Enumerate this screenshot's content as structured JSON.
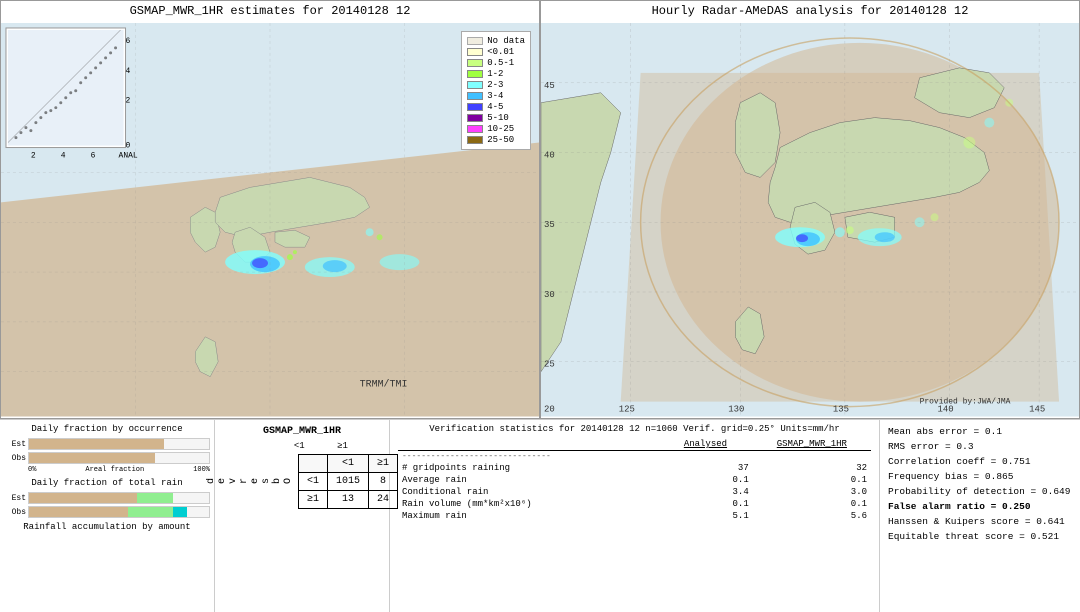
{
  "left_map": {
    "title": "GSMAP_MWR_1HR estimates for 20140128 12",
    "labels": {
      "trmm": "TRMM/TMI",
      "anal": "ANAL"
    }
  },
  "right_map": {
    "title": "Hourly Radar-AMeDAS analysis for 20140128 12",
    "credit": "Provided by:JWA/JMA",
    "lat_labels": [
      "45",
      "40",
      "35",
      "30",
      "25",
      "20"
    ],
    "lon_labels": [
      "125",
      "130",
      "135",
      "140",
      "145"
    ]
  },
  "legend": {
    "title": "No data",
    "items": [
      {
        "label": "No data",
        "color": "#f5f5f5"
      },
      {
        "label": "<0.01",
        "color": "#fffdd0"
      },
      {
        "label": "0.5-1",
        "color": "#adff2f"
      },
      {
        "label": "1-2",
        "color": "#7fff00"
      },
      {
        "label": "2-3",
        "color": "#00ffff"
      },
      {
        "label": "3-4",
        "color": "#00bfff"
      },
      {
        "label": "4-5",
        "color": "#0000ff"
      },
      {
        "label": "5-10",
        "color": "#8b008b"
      },
      {
        "label": "10-25",
        "color": "#ff00ff"
      },
      {
        "label": "25-50",
        "color": "#8b4513"
      }
    ]
  },
  "charts": {
    "occurrence_title": "Daily fraction by occurrence",
    "rain_title": "Daily fraction of total rain",
    "accumulation_title": "Rainfall accumulation by amount",
    "est_label": "Est",
    "obs_label": "Obs",
    "axis_0": "0%",
    "axis_100": "Areal fraction",
    "axis_100_pct": "100%"
  },
  "contingency": {
    "title": "GSMAP_MWR_1HR",
    "col_headers": [
      "<1",
      "≥1"
    ],
    "row_headers": [
      "<1",
      "≥1"
    ],
    "obs_label": "O\nb\ns\ne\nr\nv\ne\nd",
    "cells": {
      "a": "1015",
      "b": "8",
      "c": "13",
      "d": "24"
    }
  },
  "verification": {
    "title": "Verification statistics for 20140128 12  n=1060  Verif. grid=0.25°  Units=mm/hr",
    "col1_header": "Analysed",
    "col2_header": "GSMAP_MWR_1HR",
    "rows": [
      {
        "label": "# gridpoints raining",
        "col1": "37",
        "col2": "32"
      },
      {
        "label": "Average rain",
        "col1": "0.1",
        "col2": "0.1"
      },
      {
        "label": "Conditional rain",
        "col1": "3.4",
        "col2": "3.0"
      },
      {
        "label": "Rain volume (mm*km²x10⁶)",
        "col1": "0.1",
        "col2": "0.1"
      },
      {
        "label": "Maximum rain",
        "col1": "5.1",
        "col2": "5.6"
      }
    ]
  },
  "metrics": {
    "mean_abs_error": "Mean abs error = 0.1",
    "rms_error": "RMS error = 0.3",
    "correlation": "Correlation coeff = 0.751",
    "freq_bias": "Frequency bias = 0.865",
    "prob_detection": "Probability of detection = 0.649",
    "false_alarm": "False alarm ratio = 0.250",
    "hanssen": "Hanssen & Kuipers score = 0.641",
    "equitable": "Equitable threat score = 0.521"
  }
}
